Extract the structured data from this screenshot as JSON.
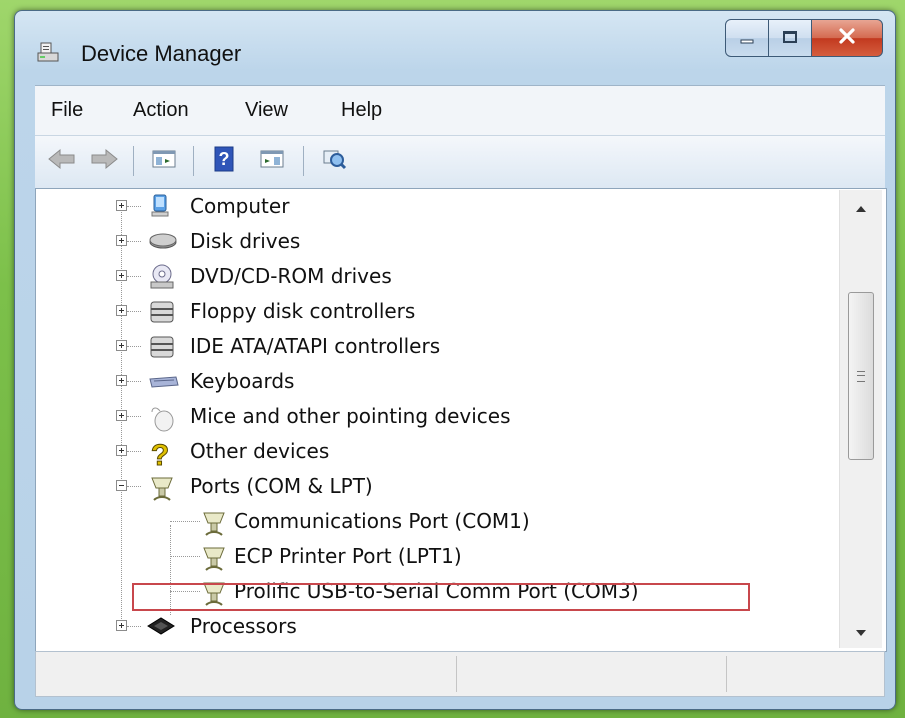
{
  "window": {
    "title": "Device Manager",
    "app_icon": "device-manager-icon",
    "caption_buttons": [
      "minimize-icon",
      "maximize-icon",
      "close-icon"
    ]
  },
  "menubar": {
    "items": [
      {
        "label": "File"
      },
      {
        "label": "Action"
      },
      {
        "label": "View"
      },
      {
        "label": "Help"
      }
    ]
  },
  "toolbar": {
    "buttons": [
      "back-arrow-icon",
      "forward-arrow-icon",
      "show-hide-console-tree-icon",
      "help-icon",
      "show-hide-action-pane-icon",
      "scan-hardware-changes-icon"
    ]
  },
  "tree": {
    "items": [
      {
        "label": "Computer",
        "icon": "computer-icon",
        "expander": "plus"
      },
      {
        "label": "Disk drives",
        "icon": "disk-drive-icon",
        "expander": "plus"
      },
      {
        "label": "DVD/CD-ROM drives",
        "icon": "dvd-drive-icon",
        "expander": "plus"
      },
      {
        "label": "Floppy disk controllers",
        "icon": "controller-icon",
        "expander": "plus"
      },
      {
        "label": "IDE ATA/ATAPI controllers",
        "icon": "controller-icon",
        "expander": "plus"
      },
      {
        "label": "Keyboards",
        "icon": "keyboard-icon",
        "expander": "plus"
      },
      {
        "label": "Mice and other pointing devices",
        "icon": "mouse-icon",
        "expander": "plus"
      },
      {
        "label": "Other devices",
        "icon": "unknown-device-icon",
        "expander": "plus"
      },
      {
        "label": "Ports (COM & LPT)",
        "icon": "port-icon",
        "expander": "minus"
      },
      {
        "label": "Communications Port (COM1)",
        "icon": "port-icon",
        "child": true
      },
      {
        "label": "ECP Printer Port (LPT1)",
        "icon": "port-icon",
        "child": true
      },
      {
        "label": "Prolific USB-to-Serial Comm Port (COM3)",
        "icon": "port-icon",
        "child": true,
        "highlighted": true
      },
      {
        "label": "Processors",
        "icon": "processor-icon",
        "expander": "plus"
      }
    ]
  },
  "colors": {
    "highlight_border": "#c8474c",
    "close_button": "#c2391f",
    "background_green": "#7cc04a"
  }
}
